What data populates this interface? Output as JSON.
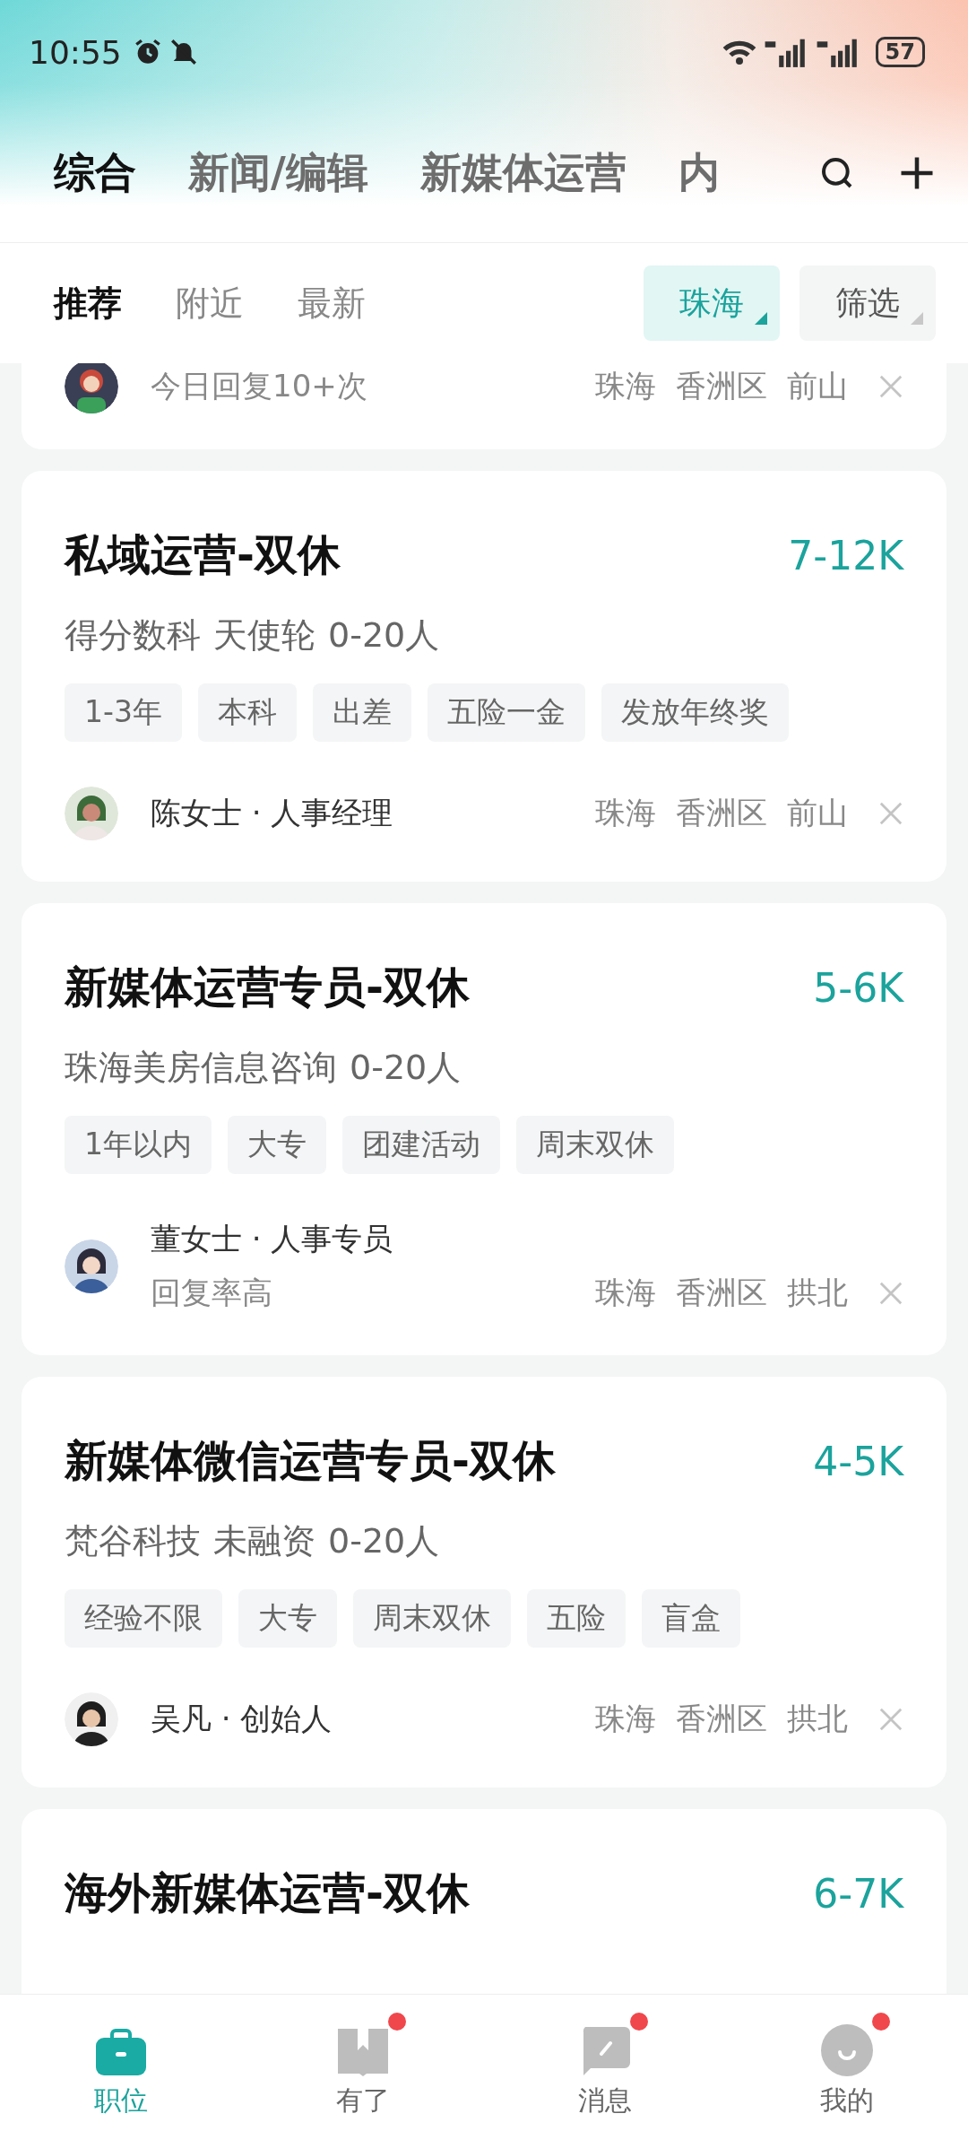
{
  "status_bar": {
    "time": "10:55",
    "battery": "57"
  },
  "tabs": [
    {
      "label": "综合",
      "selected": true
    },
    {
      "label": "新闻/编辑",
      "selected": false
    },
    {
      "label": "新媒体运营",
      "selected": false
    },
    {
      "label": "内",
      "selected": false
    }
  ],
  "sub_tabs": [
    {
      "label": "推荐",
      "selected": true
    },
    {
      "label": "附近",
      "selected": false
    },
    {
      "label": "最新",
      "selected": false
    }
  ],
  "filters": [
    {
      "label": "珠海",
      "selected": true
    },
    {
      "label": "筛选",
      "selected": false
    }
  ],
  "partial_card": {
    "note": "今日回复10+次",
    "location": [
      "珠海",
      "香洲区",
      "前山"
    ]
  },
  "jobs": [
    {
      "title": "私域运营-双休",
      "salary": "7-12K",
      "company": [
        "得分数科",
        "天使轮",
        "0-20人"
      ],
      "tags": [
        "1-3年",
        "本科",
        "出差",
        "五险一金",
        "发放年终奖"
      ],
      "recruiter": "陈女士 · 人事经理",
      "location": [
        "珠海",
        "香洲区",
        "前山"
      ]
    },
    {
      "title": "新媒体运营专员-双休",
      "salary": "5-6K",
      "company": [
        "珠海美房信息咨询",
        "0-20人"
      ],
      "tags": [
        "1年以内",
        "大专",
        "团建活动",
        "周末双休"
      ],
      "recruiter": "董女士 · 人事专员",
      "note": "回复率高",
      "location": [
        "珠海",
        "香洲区",
        "拱北"
      ]
    },
    {
      "title": "新媒体微信运营专员-双休",
      "salary": "4-5K",
      "company": [
        "梵谷科技",
        "未融资",
        "0-20人"
      ],
      "tags": [
        "经验不限",
        "大专",
        "周末双休",
        "五险",
        "盲盒"
      ],
      "recruiter": "吴凡 · 创始人",
      "location": [
        "珠海",
        "香洲区",
        "拱北"
      ]
    }
  ],
  "last_card": {
    "title": "海外新媒体运营-双休",
    "salary": "6-7K"
  },
  "nav": [
    {
      "label": "职位",
      "selected": true,
      "badge": false
    },
    {
      "label": "有了",
      "selected": false,
      "badge": true
    },
    {
      "label": "消息",
      "selected": false,
      "badge": true
    },
    {
      "label": "我的",
      "selected": false,
      "badge": true
    }
  ]
}
